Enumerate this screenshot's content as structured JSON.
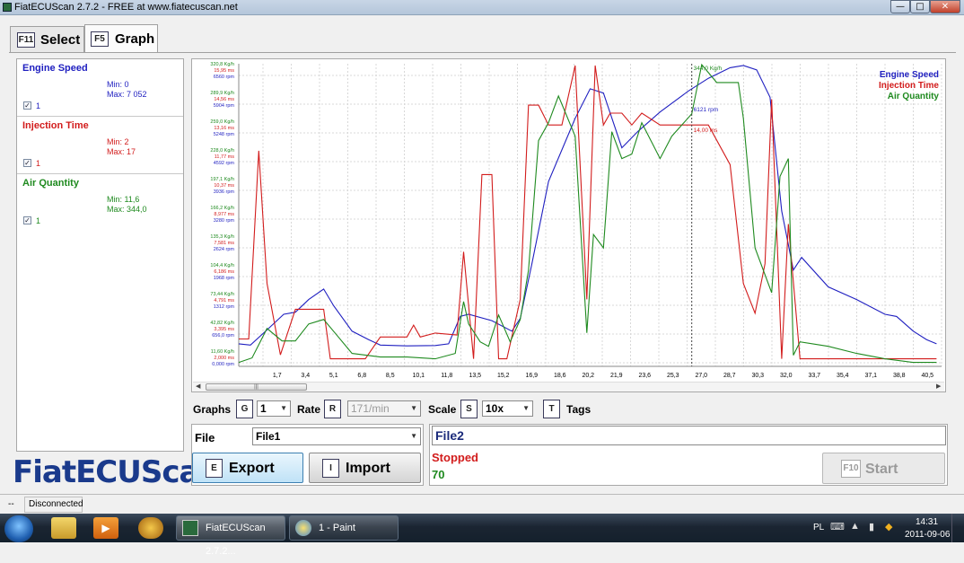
{
  "window": {
    "title": "FiatECUScan 2.7.2 - FREE at www.fiatecuscan.net"
  },
  "tabs": [
    {
      "key": "F11",
      "label": "Select"
    },
    {
      "key": "F5",
      "label": "Graph"
    }
  ],
  "channels": [
    {
      "name": "Engine Speed",
      "min": "Min: 0",
      "max": "Max: 7 052",
      "checked": true,
      "index": "1",
      "color": "#1f1fc0"
    },
    {
      "name": "Injection Time",
      "min": "Min: 2",
      "max": "Max: 17",
      "checked": true,
      "index": "1",
      "color": "#d21c1c"
    },
    {
      "name": "Air Quantity",
      "min": "Min: 11,6",
      "max": "Max: 344,0",
      "checked": true,
      "index": "1",
      "color": "#1f8a1f"
    }
  ],
  "logo": "FiatECUScan",
  "controls": {
    "graphs": {
      "label": "Graphs",
      "key": "G",
      "value": "1"
    },
    "rate": {
      "label": "Rate",
      "key": "R",
      "value": "171/min"
    },
    "scale": {
      "label": "Scale",
      "key": "S",
      "value": "10x"
    },
    "tags": {
      "label": "Tags",
      "key": "T"
    }
  },
  "file": {
    "label": "File",
    "value": "File1",
    "export": {
      "key": "E",
      "label": "Export"
    },
    "import": {
      "key": "I",
      "label": "Import"
    }
  },
  "status": {
    "filename": "File2",
    "state": "Stopped",
    "count": "70",
    "start": {
      "key": "F10",
      "label": "Start"
    }
  },
  "statusbar": {
    "left": "--",
    "connection": "Disconnected"
  },
  "taskbar": {
    "items": [
      "FiatECUScan 2.7.2...",
      "1 - Paint"
    ],
    "lang": "PL",
    "time": "14:31",
    "date": "2011-09-06"
  },
  "colors": {
    "engine": "#1f1fc0",
    "injection": "#d21c1c",
    "air": "#1f8a1f"
  },
  "chart_data": {
    "type": "line",
    "x_ticks": [
      "1,7",
      "3,4",
      "5,1",
      "6,8",
      "8,5",
      "10,1",
      "11,8",
      "13,5",
      "15,2",
      "16,9",
      "18,6",
      "20,2",
      "21,9",
      "23,6",
      "25,3",
      "27,0",
      "28,7",
      "30,3",
      "32,0",
      "33,7",
      "35,4",
      "37,1",
      "38,8",
      "40,5"
    ],
    "y_label_groups": [
      {
        "air": "11,60 Kg/h",
        "inj": "2,000 ms",
        "rpm": "0,000 rpm"
      },
      {
        "air": "42,82 Kg/h",
        "inj": "3,395 ms",
        "rpm": "656,0 rpm"
      },
      {
        "air": "73,44 Kg/h",
        "inj": "4,791 ms",
        "rpm": "1312 rpm"
      },
      {
        "air": "104,4 Kg/h",
        "inj": "6,186 ms",
        "rpm": "1968 rpm"
      },
      {
        "air": "135,3 Kg/h",
        "inj": "7,581 ms",
        "rpm": "2624 rpm"
      },
      {
        "air": "166,2 Kg/h",
        "inj": "8,977 ms",
        "rpm": "3280 rpm"
      },
      {
        "air": "197,1 Kg/h",
        "inj": "10,37 ms",
        "rpm": "3936 rpm"
      },
      {
        "air": "228,0 Kg/h",
        "inj": "11,77 ms",
        "rpm": "4592 rpm"
      },
      {
        "air": "259,0 Kg/h",
        "inj": "13,16 ms",
        "rpm": "5248 rpm"
      },
      {
        "air": "289,9 Kg/h",
        "inj": "14,56 ms",
        "rpm": "5904 rpm"
      },
      {
        "air": "320,8 Kg/h",
        "inj": "15,95 ms",
        "rpm": "6560 rpm"
      }
    ],
    "legend": [
      "Engine Speed",
      "Injection Time",
      "Air Quantity"
    ],
    "cursor": {
      "x": 27.2,
      "labels": [
        "344,0 Kg/h",
        "6121 rpm",
        "14,00 ms"
      ]
    },
    "xlim": [
      0,
      42.2
    ],
    "series": [
      {
        "name": "Engine Speed",
        "unit": "rpm",
        "ylim": [
          0,
          7052
        ],
        "x": [
          0,
          0.7,
          1.7,
          2.7,
          3.4,
          4.2,
          5.1,
          5.7,
          6.8,
          7.8,
          8.5,
          10.1,
          11.8,
          12.6,
          13.3,
          13.8,
          15.2,
          16.4,
          16.9,
          17.6,
          18.6,
          20.2,
          21.1,
          21.9,
          23.0,
          24.0,
          25.3,
          27.0,
          28.2,
          29.5,
          30.3,
          31.1,
          31.9,
          32.6,
          33.3,
          33.8,
          35.4,
          37.1,
          38.8,
          39.5,
          40.5,
          41.3,
          41.9
        ],
        "y": [
          450,
          420,
          780,
          1150,
          1200,
          1500,
          1750,
          1350,
          750,
          550,
          420,
          400,
          410,
          450,
          1100,
          1150,
          1000,
          750,
          1050,
          2350,
          4300,
          5800,
          6500,
          6400,
          5100,
          5500,
          5950,
          6450,
          6750,
          7000,
          7052,
          6950,
          6300,
          3600,
          2200,
          2500,
          1800,
          1500,
          1150,
          1100,
          750,
          550,
          450
        ]
      },
      {
        "name": "Injection Time",
        "unit": "ms",
        "ylim": [
          2,
          17
        ],
        "x": [
          0,
          0.6,
          1.2,
          1.7,
          2.5,
          3.4,
          4.0,
          5.1,
          5.5,
          6.3,
          7.6,
          8.5,
          10.1,
          10.5,
          10.9,
          11.8,
          13.1,
          13.5,
          14.1,
          14.6,
          15.2,
          15.6,
          16.1,
          16.9,
          17.4,
          18.0,
          18.6,
          19.4,
          20.2,
          20.9,
          21.4,
          21.9,
          22.3,
          23.0,
          23.6,
          24.2,
          25.3,
          26.5,
          27.2,
          28.2,
          29.5,
          30.3,
          31.0,
          31.6,
          32.0,
          32.6,
          33.0,
          33.7,
          35.4,
          37.1,
          38.8,
          39.5,
          40.5,
          41.9
        ],
        "y": [
          3.2,
          3.2,
          12.7,
          6.0,
          2.4,
          4.7,
          4.7,
          4.7,
          2.2,
          2.2,
          2.2,
          3.3,
          3.3,
          3.9,
          3.3,
          3.5,
          3.4,
          7.6,
          2.2,
          11.5,
          11.5,
          2.2,
          2.2,
          5.2,
          15.0,
          15.0,
          14.0,
          14.0,
          17.0,
          5.2,
          17.0,
          14.0,
          14.6,
          14.6,
          14.0,
          14.6,
          14.0,
          14.0,
          14.0,
          14.0,
          12.0,
          6.0,
          4.5,
          7.0,
          15.3,
          2.2,
          9.0,
          2.2,
          2.2,
          2.2,
          2.2,
          2.2,
          2.2,
          2.2
        ]
      },
      {
        "name": "Air Quantity",
        "unit": "Kg/h",
        "ylim": [
          11.6,
          344
        ],
        "x": [
          0,
          0.8,
          1.7,
          2.6,
          3.4,
          4.2,
          5.1,
          6.0,
          6.8,
          8.5,
          10.1,
          11.8,
          13.0,
          13.5,
          13.8,
          14.5,
          15.0,
          15.6,
          16.3,
          16.9,
          17.4,
          18.0,
          18.6,
          19.2,
          20.2,
          20.9,
          21.3,
          21.9,
          22.4,
          23.0,
          23.6,
          24.2,
          25.3,
          26.0,
          27.2,
          27.8,
          28.7,
          29.5,
          30.0,
          30.3,
          31.0,
          32.0,
          32.5,
          33.0,
          33.3,
          33.7,
          35.4,
          37.1,
          38.8,
          40.5,
          41.9
        ],
        "y": [
          12,
          17,
          50,
          36,
          36,
          55,
          60,
          40,
          22,
          18,
          18,
          16,
          22,
          80,
          55,
          35,
          30,
          65,
          35,
          60,
          115,
          260,
          280,
          310,
          265,
          45,
          155,
          140,
          270,
          240,
          245,
          280,
          240,
          265,
          290,
          345,
          325,
          325,
          325,
          285,
          140,
          90,
          220,
          240,
          20,
          35,
          30,
          22,
          16,
          12,
          12
        ]
      }
    ]
  }
}
